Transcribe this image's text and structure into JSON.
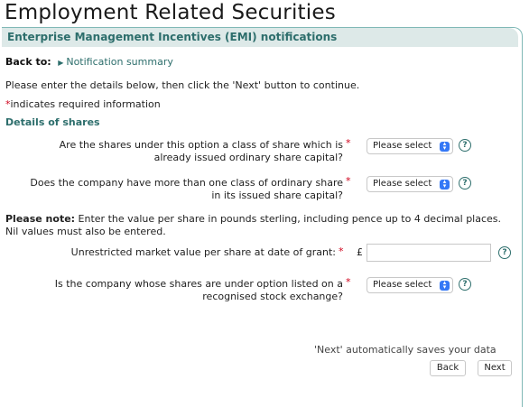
{
  "page_title": "Employment Related Securities",
  "section_header": "Enterprise Management Incentives (EMI) notifications",
  "back": {
    "label": "Back to:",
    "link_text": "Notification summary"
  },
  "instructions": "Please enter the details below, then click the 'Next' button to continue.",
  "required_note": {
    "star": "*",
    "text": "indicates required information"
  },
  "subheading": "Details of shares",
  "questions": [
    {
      "line1": "Are the shares under this option a class of share which is",
      "line2": "already issued ordinary share capital?",
      "select": "Please select"
    },
    {
      "line1": "Does the company have more than one class of ordinary share",
      "line2": "in its issued share capital?",
      "select": "Please select"
    },
    {
      "line1": "Is the company whose shares are under option listed on a",
      "line2": "recognised stock exchange?",
      "select": "Please select"
    }
  ],
  "note": {
    "bold": "Please note:",
    "text": " Enter the value per share in pounds sterling, including pence up to 4 decimal places. Nil values must also be entered."
  },
  "market_value": {
    "label": "Unrestricted market value per share at date of grant:",
    "currency": "£",
    "value": ""
  },
  "footer_note": "'Next' automatically saves your data",
  "buttons": {
    "back": "Back",
    "next": "Next"
  },
  "colors": {
    "accent": "#2d6e6c",
    "header_bg": "#dde9e8",
    "required": "#d0021b",
    "select_arrow": "#3478f6"
  },
  "icons": {
    "help": "help-icon",
    "select": "chevron-updown-icon",
    "back_link": "triangle-right-icon"
  }
}
